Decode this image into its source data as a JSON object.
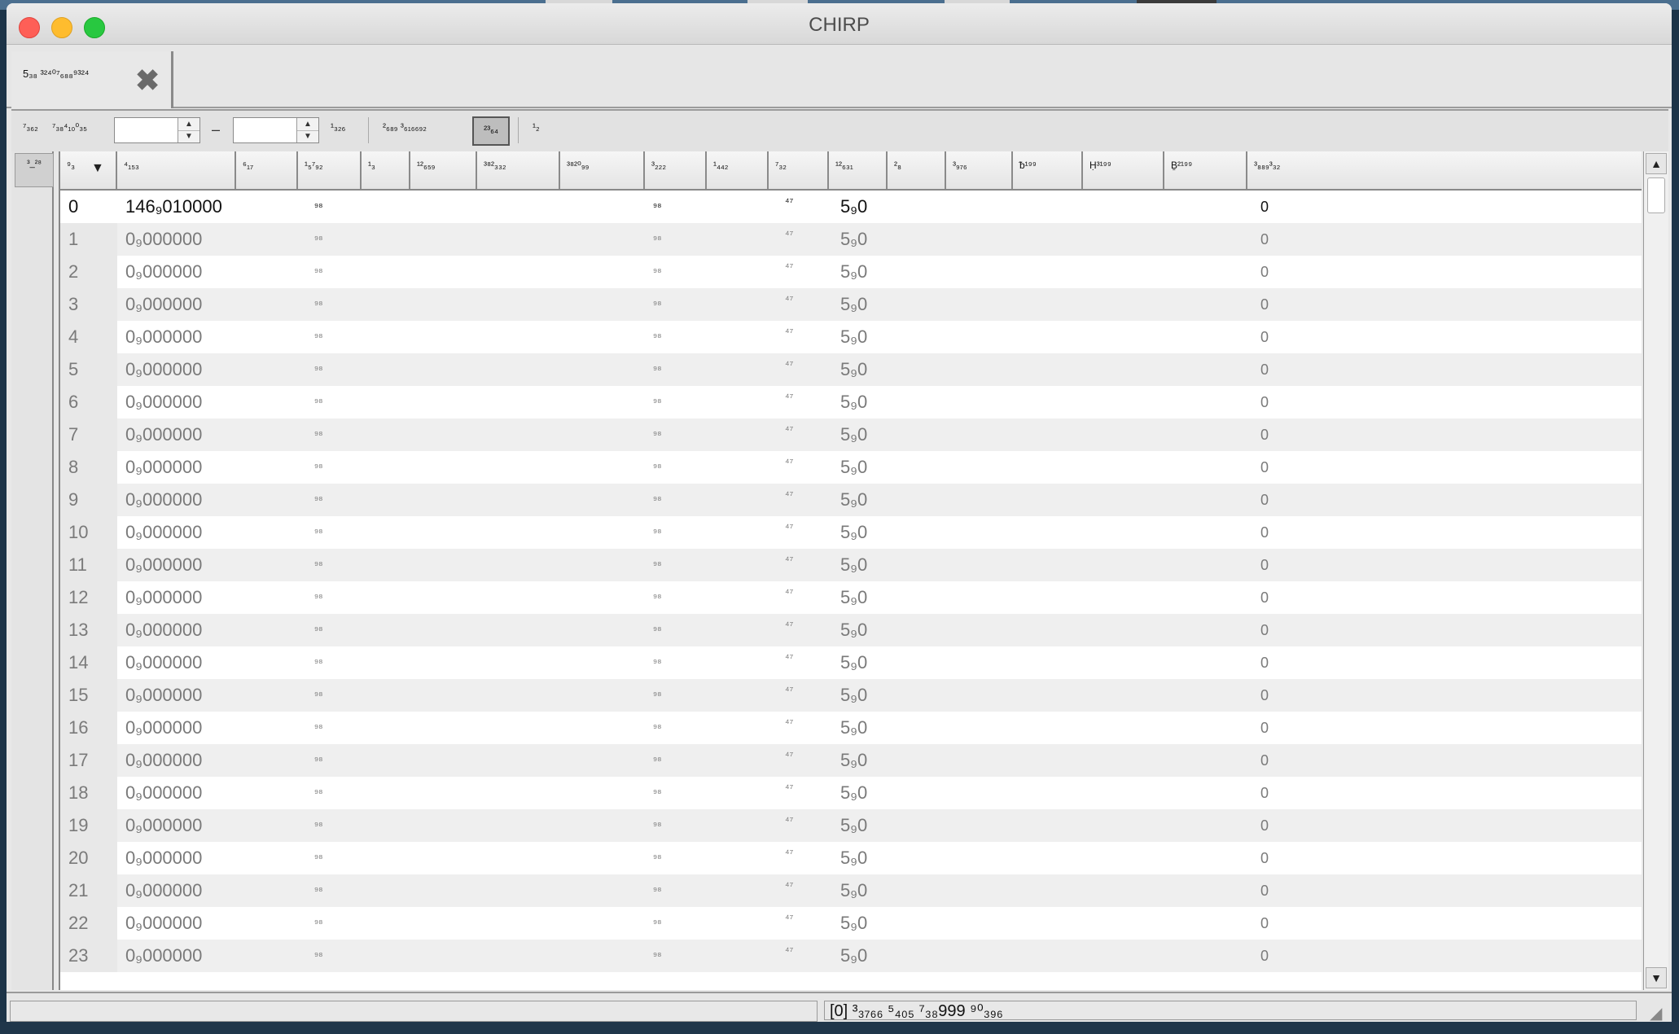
{
  "window": {
    "title": "CHIRP"
  },
  "tab": {
    "label": "5₃₈ ³²⁴⁰⁷₆₈₈⁹³²⁴",
    "close_icon": "close-x-icon"
  },
  "toolbar": {
    "label1": "⁷₃₆₂",
    "label2": "⁷₃₈⁴₁₀⁰₃₅",
    "range_from": "",
    "range_to": "",
    "range_separator": "–",
    "label3": "¹₃₂₆",
    "label4": "²₆₈₉ ³₆₁₆₆₉₂",
    "toggle": "²³₆₄",
    "label5": "¹₂"
  },
  "sidebar": {
    "button": "³_²⁸"
  },
  "table": {
    "headers": [
      "⁹₃",
      "⁴₁₅₃",
      "⁶₁₇",
      "¹₅⁷₉₂",
      "¹₃",
      "¹²₆₅₉",
      "³⁸²₃₃₂",
      "³⁸²⁰₉₉",
      "³₂₂₂",
      "¹₄₄₂",
      "⁷₃₂",
      "¹²₆₃₁",
      "²₈",
      "³₉₇₆",
      "ᵬ¹⁹⁹",
      "Ḥ³¹⁹⁹",
      "Ḇ²¹⁹⁹",
      "³₈₈₉³₃₂"
    ],
    "rows": [
      {
        "index": "0",
        "freq": "146₉010000",
        "col_a": "₉₈",
        "col_b": "₉₈",
        "col_c": "⁴⁷",
        "col_d": "5₉0",
        "col_e": "0"
      },
      {
        "index": "1",
        "freq": "0₉000000",
        "col_a": "₉₈",
        "col_b": "₉₈",
        "col_c": "⁴⁷",
        "col_d": "5₉0",
        "col_e": "0"
      },
      {
        "index": "2",
        "freq": "0₉000000",
        "col_a": "₉₈",
        "col_b": "₉₈",
        "col_c": "⁴⁷",
        "col_d": "5₉0",
        "col_e": "0"
      },
      {
        "index": "3",
        "freq": "0₉000000",
        "col_a": "₉₈",
        "col_b": "₉₈",
        "col_c": "⁴⁷",
        "col_d": "5₉0",
        "col_e": "0"
      },
      {
        "index": "4",
        "freq": "0₉000000",
        "col_a": "₉₈",
        "col_b": "₉₈",
        "col_c": "⁴⁷",
        "col_d": "5₉0",
        "col_e": "0"
      },
      {
        "index": "5",
        "freq": "0₉000000",
        "col_a": "₉₈",
        "col_b": "₉₈",
        "col_c": "⁴⁷",
        "col_d": "5₉0",
        "col_e": "0"
      },
      {
        "index": "6",
        "freq": "0₉000000",
        "col_a": "₉₈",
        "col_b": "₉₈",
        "col_c": "⁴⁷",
        "col_d": "5₉0",
        "col_e": "0"
      },
      {
        "index": "7",
        "freq": "0₉000000",
        "col_a": "₉₈",
        "col_b": "₉₈",
        "col_c": "⁴⁷",
        "col_d": "5₉0",
        "col_e": "0"
      },
      {
        "index": "8",
        "freq": "0₉000000",
        "col_a": "₉₈",
        "col_b": "₉₈",
        "col_c": "⁴⁷",
        "col_d": "5₉0",
        "col_e": "0"
      },
      {
        "index": "9",
        "freq": "0₉000000",
        "col_a": "₉₈",
        "col_b": "₉₈",
        "col_c": "⁴⁷",
        "col_d": "5₉0",
        "col_e": "0"
      },
      {
        "index": "10",
        "freq": "0₉000000",
        "col_a": "₉₈",
        "col_b": "₉₈",
        "col_c": "⁴⁷",
        "col_d": "5₉0",
        "col_e": "0"
      },
      {
        "index": "11",
        "freq": "0₉000000",
        "col_a": "₉₈",
        "col_b": "₉₈",
        "col_c": "⁴⁷",
        "col_d": "5₉0",
        "col_e": "0"
      },
      {
        "index": "12",
        "freq": "0₉000000",
        "col_a": "₉₈",
        "col_b": "₉₈",
        "col_c": "⁴⁷",
        "col_d": "5₉0",
        "col_e": "0"
      },
      {
        "index": "13",
        "freq": "0₉000000",
        "col_a": "₉₈",
        "col_b": "₉₈",
        "col_c": "⁴⁷",
        "col_d": "5₉0",
        "col_e": "0"
      },
      {
        "index": "14",
        "freq": "0₉000000",
        "col_a": "₉₈",
        "col_b": "₉₈",
        "col_c": "⁴⁷",
        "col_d": "5₉0",
        "col_e": "0"
      },
      {
        "index": "15",
        "freq": "0₉000000",
        "col_a": "₉₈",
        "col_b": "₉₈",
        "col_c": "⁴⁷",
        "col_d": "5₉0",
        "col_e": "0"
      },
      {
        "index": "16",
        "freq": "0₉000000",
        "col_a": "₉₈",
        "col_b": "₉₈",
        "col_c": "⁴⁷",
        "col_d": "5₉0",
        "col_e": "0"
      },
      {
        "index": "17",
        "freq": "0₉000000",
        "col_a": "₉₈",
        "col_b": "₉₈",
        "col_c": "⁴⁷",
        "col_d": "5₉0",
        "col_e": "0"
      },
      {
        "index": "18",
        "freq": "0₉000000",
        "col_a": "₉₈",
        "col_b": "₉₈",
        "col_c": "⁴⁷",
        "col_d": "5₉0",
        "col_e": "0"
      },
      {
        "index": "19",
        "freq": "0₉000000",
        "col_a": "₉₈",
        "col_b": "₉₈",
        "col_c": "⁴⁷",
        "col_d": "5₉0",
        "col_e": "0"
      },
      {
        "index": "20",
        "freq": "0₉000000",
        "col_a": "₉₈",
        "col_b": "₉₈",
        "col_c": "⁴⁷",
        "col_d": "5₉0",
        "col_e": "0"
      },
      {
        "index": "21",
        "freq": "0₉000000",
        "col_a": "₉₈",
        "col_b": "₉₈",
        "col_c": "⁴⁷",
        "col_d": "5₉0",
        "col_e": "0"
      },
      {
        "index": "22",
        "freq": "0₉000000",
        "col_a": "₉₈",
        "col_b": "₉₈",
        "col_c": "⁴⁷",
        "col_d": "5₉0",
        "col_e": "0"
      },
      {
        "index": "23",
        "freq": "0₉000000",
        "col_a": "₉₈",
        "col_b": "₉₈",
        "col_c": "⁴⁷",
        "col_d": "5₉0",
        "col_e": "0"
      }
    ]
  },
  "statusbar": {
    "left": "",
    "right": "[0] ³₃₇₆₆ ⁵₄₀₅ ⁷₃₈999 ⁹⁰₃₉₆"
  }
}
